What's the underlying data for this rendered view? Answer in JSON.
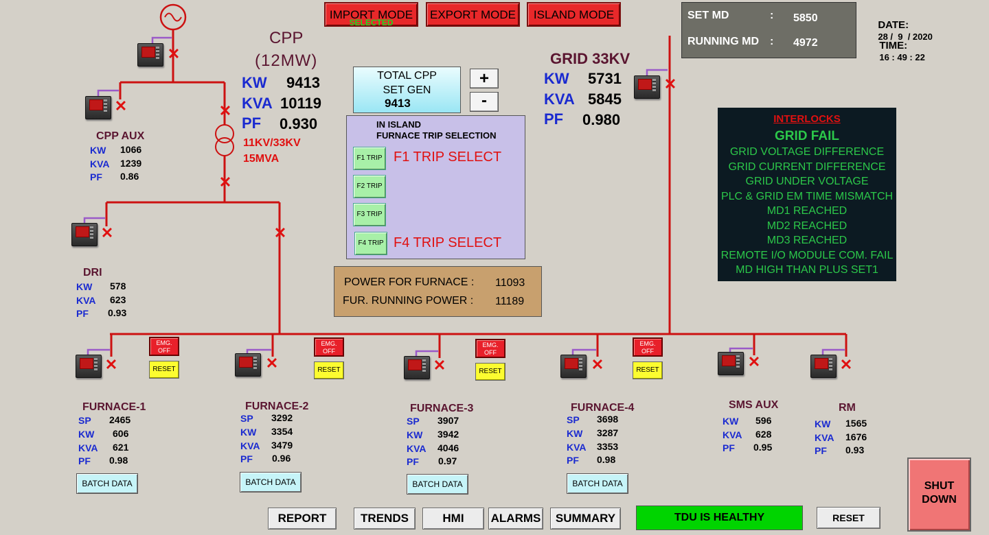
{
  "modes": {
    "import": "IMPORT MODE",
    "import_status": "SELECTED",
    "export": "EXPORT MODE",
    "island": "ISLAND MODE"
  },
  "md": {
    "set_label": "SET MD",
    "set_value": "5850",
    "running_label": "RUNNING MD",
    "running_value": "4972",
    "sep": ":"
  },
  "datetime": {
    "date_label": "DATE:",
    "date_value": "28 /  9  / 2020",
    "time_label": "TIME:",
    "time_value": "16 : 49 : 22"
  },
  "cpp": {
    "title": "CPP",
    "capacity": "(12MW)",
    "kw_label": "KW",
    "kw": "9413",
    "kva_label": "KVA",
    "kva": "10119",
    "pf_label": "PF",
    "pf": "0.930"
  },
  "transformer": {
    "ratio": "11KV/33KV",
    "rating": "15MVA"
  },
  "cpp_aux": {
    "title": "CPP AUX",
    "kw_label": "KW",
    "kw": "1066",
    "kva_label": "KVA",
    "kva": "1239",
    "pf_label": "PF",
    "pf": "0.86"
  },
  "dri": {
    "title": "DRI",
    "kw_label": "KW",
    "kw": "578",
    "kva_label": "KVA",
    "kva": "623",
    "pf_label": "PF",
    "pf": "0.93"
  },
  "grid": {
    "title": "GRID 33KV",
    "kw_label": "KW",
    "kw": "5731",
    "kva_label": "KVA",
    "kva": "5845",
    "pf_label": "PF",
    "pf": "0.980"
  },
  "set_gen": {
    "line1": "TOTAL CPP",
    "line2": "SET GEN",
    "value": "9413",
    "plus": "+",
    "minus": "-"
  },
  "trip_panel": {
    "line1": "IN ISLAND",
    "line2": "FURNACE TRIP SELECTION",
    "f1": "F1 TRIP",
    "f2": "F2 TRIP",
    "f3": "F3 TRIP",
    "f4": "F4 TRIP",
    "f1_selected": "F1 TRIP SELECT",
    "f4_selected": "F4 TRIP SELECT"
  },
  "furnace_power": {
    "power_label": "POWER FOR FURNACE :",
    "power_value": "11093",
    "running_label": "FUR. RUNNING POWER :",
    "running_value": "11189"
  },
  "interlocks": {
    "title": "INTERLOCKS",
    "status": "GRID FAIL",
    "items": [
      "GRID VOLTAGE DIFFERENCE",
      "GRID CURRENT DIFFERENCE",
      "GRID UNDER VOLTAGE",
      "PLC & GRID EM TIME MISMATCH",
      "MD1 REACHED",
      "MD2 REACHED",
      "MD3 REACHED",
      "REMOTE I/O MODULE COM. FAIL",
      "MD HIGH THAN PLUS SET1"
    ]
  },
  "feeder_buttons": {
    "emg_line1": "EMG.",
    "emg_line2": "OFF",
    "reset": "RESET",
    "batch": "BATCH DATA"
  },
  "furnaces": [
    {
      "title": "FURNACE-1",
      "sp_label": "SP",
      "sp": "2465",
      "kw_label": "KW",
      "kw": "606",
      "kva_label": "KVA",
      "kva": "621",
      "pf_label": "PF",
      "pf": "0.98"
    },
    {
      "title": "FURNACE-2",
      "sp_label": "SP",
      "sp": "3292",
      "kw_label": "KW",
      "kw": "3354",
      "kva_label": "KVA",
      "kva": "3479",
      "pf_label": "PF",
      "pf": "0.96"
    },
    {
      "title": "FURNACE-3",
      "sp_label": "SP",
      "sp": "3907",
      "kw_label": "KW",
      "kw": "3942",
      "kva_label": "KVA",
      "kva": "4046",
      "pf_label": "PF",
      "pf": "0.97"
    },
    {
      "title": "FURNACE-4",
      "sp_label": "SP",
      "sp": "3698",
      "kw_label": "KW",
      "kw": "3287",
      "kva_label": "KVA",
      "kva": "3353",
      "pf_label": "PF",
      "pf": "0.98"
    }
  ],
  "sms_aux": {
    "title": "SMS AUX",
    "kw_label": "KW",
    "kw": "596",
    "kva_label": "KVA",
    "kva": "628",
    "pf_label": "PF",
    "pf": "0.95"
  },
  "rm": {
    "title": "RM",
    "kw_label": "KW",
    "kw": "1565",
    "kva_label": "KVA",
    "kva": "1676",
    "pf_label": "PF",
    "pf": "0.93"
  },
  "nav": {
    "report": "REPORT",
    "trends": "TRENDS",
    "hmi": "HMI",
    "alarms": "ALARMS",
    "summary": "SUMMARY"
  },
  "status": {
    "tdu": "TDU IS HEALTHY",
    "reset": "RESET",
    "shutdown_line1": "SHUT",
    "shutdown_line2": "DOWN"
  },
  "colors": {
    "busbar": "#cc1111",
    "background": "#d4d0c8",
    "interlock_panel": "#0c1a22",
    "interlock_text": "#2cc84a",
    "healthy": "#00d400"
  }
}
